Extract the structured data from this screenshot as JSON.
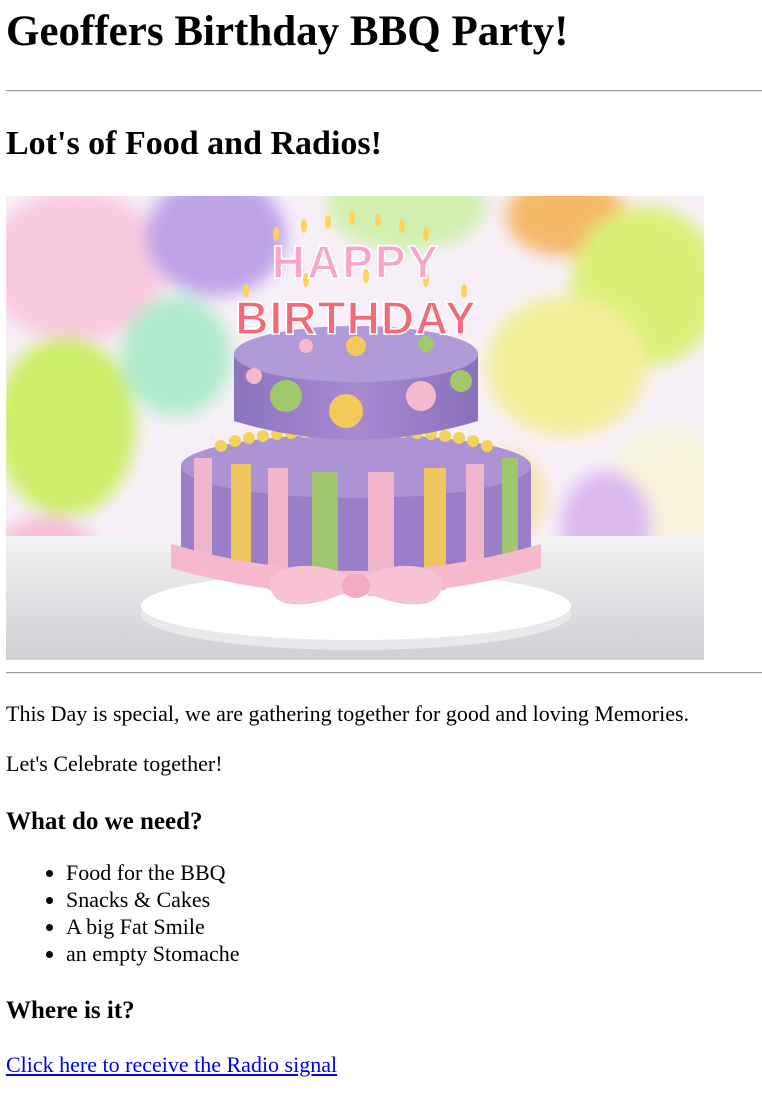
{
  "header": {
    "title": "Geoffers Birthday BBQ Party!",
    "subtitle": "Lot's of Food and Radios!"
  },
  "hero_image": {
    "topper_line1": "HAPPY",
    "topper_line2": "BIRTHDAY",
    "colors": {
      "cake_purple": "#9a7fc6",
      "ribbon_pink": "#f5b8cc",
      "stripe_yellow": "#f3c95a",
      "stripe_green": "#9fc96a",
      "dot_orange": "#e8a24a"
    }
  },
  "main": {
    "paragraph1": "This Day is special, we are gathering together for good and loving Memories.",
    "paragraph2": "Let's Celebrate together!",
    "need_heading": "What do we need?",
    "need_items": [
      "Food for the BBQ",
      "Snacks & Cakes",
      "A big Fat Smile",
      "an empty Stomache"
    ],
    "where_heading": "Where is it?",
    "radio_link": "Click here to receive the Radio signal"
  }
}
